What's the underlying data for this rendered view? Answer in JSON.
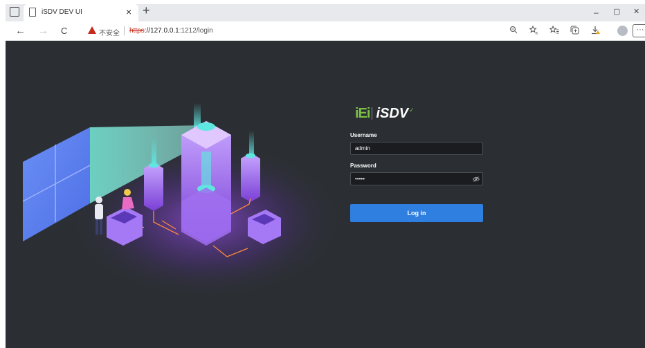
{
  "browser": {
    "tab_title": "iSDV DEV UI",
    "tab_close": "×",
    "new_tab": "+",
    "minimize": "–",
    "restore": "▢",
    "close": "✕",
    "back": "←",
    "forward": "→",
    "refresh": "C",
    "security_text": "不安全",
    "url_scheme": "https",
    "url_host": "://127.0.0.1",
    "url_rest": ":1212/login",
    "more_label": "···",
    "icons": [
      "zoom-icon",
      "read-aloud-icon",
      "favorites-icon",
      "collections-icon",
      "downloads-icon",
      "profile-icon",
      "more-icon"
    ]
  },
  "login": {
    "logo_iei": "iEi",
    "logo_isdv": "iSDV",
    "username_label": "Username",
    "username_value": "admin",
    "password_label": "Password",
    "password_value": "•••••",
    "login_button": "Log in"
  },
  "colors": {
    "page_bg": "#2b2f33",
    "accent": "#2f7fe0",
    "logo_green": "#7ac143",
    "illustration_purple": "#8a4fe0",
    "illustration_cyan": "#5fe6e0"
  }
}
